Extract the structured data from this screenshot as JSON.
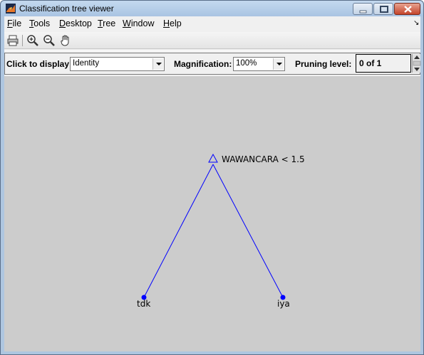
{
  "window": {
    "title": "Classification tree viewer",
    "accent": "#aec6e0"
  },
  "menubar": {
    "items": [
      {
        "label": "File",
        "mnemonic": "F",
        "rest": "ile"
      },
      {
        "label": "Tools",
        "mnemonic": "T",
        "rest": "ools"
      },
      {
        "label": "Desktop",
        "mnemonic": "D",
        "rest": "esktop"
      },
      {
        "label": "Tree",
        "mnemonic": "T",
        "rest": "ree"
      },
      {
        "label": "Window",
        "mnemonic": "W",
        "rest": "indow"
      },
      {
        "label": "Help",
        "mnemonic": "H",
        "rest": "elp"
      }
    ]
  },
  "toolbar": {
    "icons": [
      "printer-icon",
      "zoom-in-icon",
      "zoom-out-icon",
      "pan-hand-icon"
    ]
  },
  "panel": {
    "display_label": "Click to display:",
    "display_value": "Identity",
    "magnification_label": "Magnification:",
    "magnification_value": "100%",
    "pruning_label": "Pruning level:",
    "pruning_value": "0 of 1"
  },
  "tree": {
    "line_color": "#0000ff",
    "root": {
      "label": "WAWANCARA < 1.5"
    },
    "leaves": [
      {
        "label": "tdk"
      },
      {
        "label": "iya"
      }
    ]
  }
}
